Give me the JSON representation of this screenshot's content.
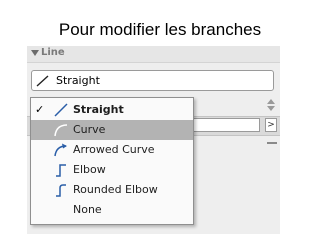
{
  "slide_title": "Pour modifier les branches",
  "section": {
    "title": "Line",
    "icon": "disclosure-triangle-icon"
  },
  "select": {
    "value": "Straight",
    "icon": "straight-line-icon"
  },
  "menu": {
    "items": [
      {
        "label": "Straight",
        "icon": "straight-line-icon",
        "checked": true,
        "check_mark": "✓",
        "bold": true
      },
      {
        "label": "Curve",
        "icon": "curve-line-icon",
        "highlighted": true
      },
      {
        "label": "Arrowed Curve",
        "icon": "arrowed-curve-icon"
      },
      {
        "label": "Elbow",
        "icon": "elbow-line-icon"
      },
      {
        "label": "Rounded Elbow",
        "icon": "rounded-elbow-icon"
      },
      {
        "label": "None",
        "icon": ""
      }
    ]
  },
  "side_controls": {
    "stepper_icon": "up-down-stepper-icon",
    "forward_arrow": ">",
    "forward_icon": "chevron-right-icon"
  },
  "colors": {
    "highlight": "#b3b3b3",
    "icon_blue": "#2a5ea8",
    "panel_bg": "#eeeeee"
  }
}
